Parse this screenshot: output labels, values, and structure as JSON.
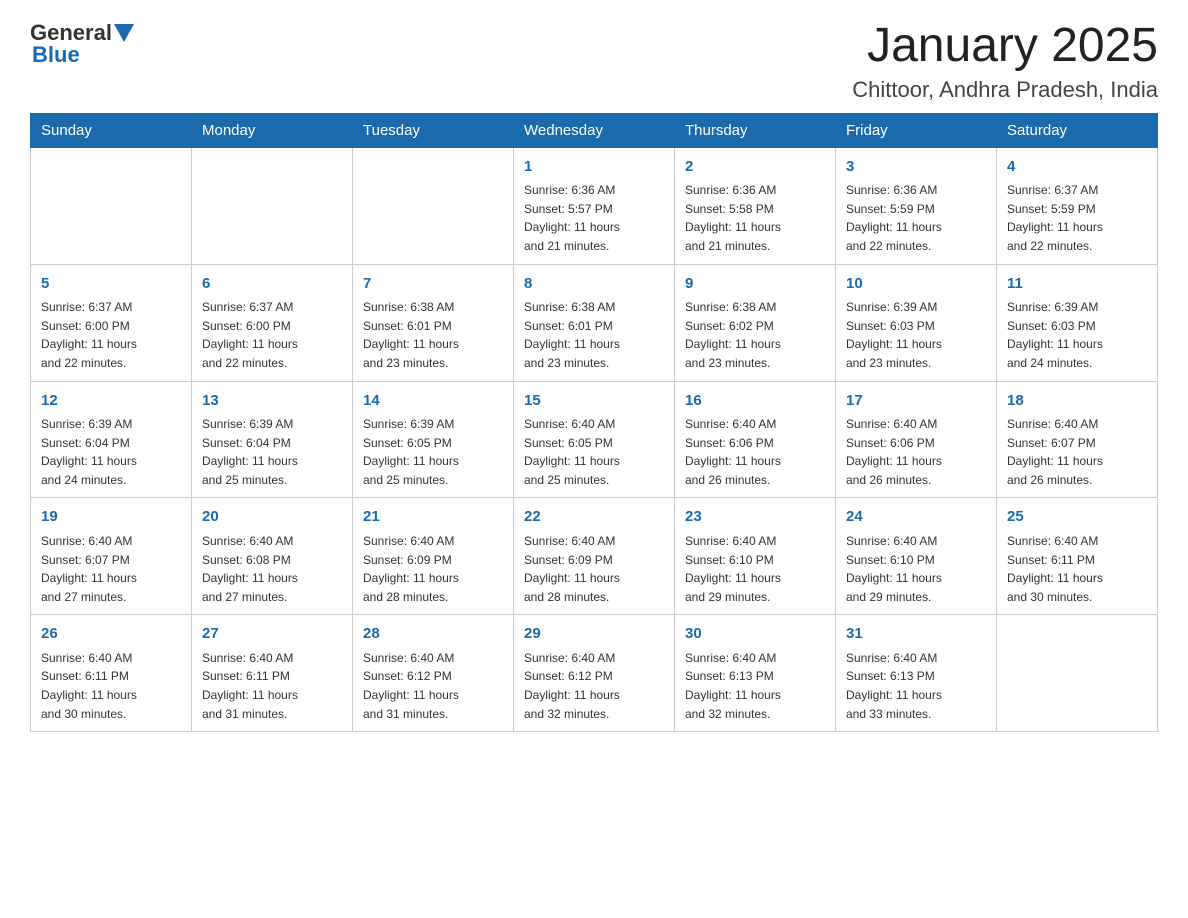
{
  "header": {
    "logo_general": "General",
    "logo_blue": "Blue",
    "month_title": "January 2025",
    "location": "Chittoor, Andhra Pradesh, India"
  },
  "weekdays": [
    "Sunday",
    "Monday",
    "Tuesday",
    "Wednesday",
    "Thursday",
    "Friday",
    "Saturday"
  ],
  "weeks": [
    [
      {
        "day": "",
        "info": ""
      },
      {
        "day": "",
        "info": ""
      },
      {
        "day": "",
        "info": ""
      },
      {
        "day": "1",
        "info": "Sunrise: 6:36 AM\nSunset: 5:57 PM\nDaylight: 11 hours\nand 21 minutes."
      },
      {
        "day": "2",
        "info": "Sunrise: 6:36 AM\nSunset: 5:58 PM\nDaylight: 11 hours\nand 21 minutes."
      },
      {
        "day": "3",
        "info": "Sunrise: 6:36 AM\nSunset: 5:59 PM\nDaylight: 11 hours\nand 22 minutes."
      },
      {
        "day": "4",
        "info": "Sunrise: 6:37 AM\nSunset: 5:59 PM\nDaylight: 11 hours\nand 22 minutes."
      }
    ],
    [
      {
        "day": "5",
        "info": "Sunrise: 6:37 AM\nSunset: 6:00 PM\nDaylight: 11 hours\nand 22 minutes."
      },
      {
        "day": "6",
        "info": "Sunrise: 6:37 AM\nSunset: 6:00 PM\nDaylight: 11 hours\nand 22 minutes."
      },
      {
        "day": "7",
        "info": "Sunrise: 6:38 AM\nSunset: 6:01 PM\nDaylight: 11 hours\nand 23 minutes."
      },
      {
        "day": "8",
        "info": "Sunrise: 6:38 AM\nSunset: 6:01 PM\nDaylight: 11 hours\nand 23 minutes."
      },
      {
        "day": "9",
        "info": "Sunrise: 6:38 AM\nSunset: 6:02 PM\nDaylight: 11 hours\nand 23 minutes."
      },
      {
        "day": "10",
        "info": "Sunrise: 6:39 AM\nSunset: 6:03 PM\nDaylight: 11 hours\nand 23 minutes."
      },
      {
        "day": "11",
        "info": "Sunrise: 6:39 AM\nSunset: 6:03 PM\nDaylight: 11 hours\nand 24 minutes."
      }
    ],
    [
      {
        "day": "12",
        "info": "Sunrise: 6:39 AM\nSunset: 6:04 PM\nDaylight: 11 hours\nand 24 minutes."
      },
      {
        "day": "13",
        "info": "Sunrise: 6:39 AM\nSunset: 6:04 PM\nDaylight: 11 hours\nand 25 minutes."
      },
      {
        "day": "14",
        "info": "Sunrise: 6:39 AM\nSunset: 6:05 PM\nDaylight: 11 hours\nand 25 minutes."
      },
      {
        "day": "15",
        "info": "Sunrise: 6:40 AM\nSunset: 6:05 PM\nDaylight: 11 hours\nand 25 minutes."
      },
      {
        "day": "16",
        "info": "Sunrise: 6:40 AM\nSunset: 6:06 PM\nDaylight: 11 hours\nand 26 minutes."
      },
      {
        "day": "17",
        "info": "Sunrise: 6:40 AM\nSunset: 6:06 PM\nDaylight: 11 hours\nand 26 minutes."
      },
      {
        "day": "18",
        "info": "Sunrise: 6:40 AM\nSunset: 6:07 PM\nDaylight: 11 hours\nand 26 minutes."
      }
    ],
    [
      {
        "day": "19",
        "info": "Sunrise: 6:40 AM\nSunset: 6:07 PM\nDaylight: 11 hours\nand 27 minutes."
      },
      {
        "day": "20",
        "info": "Sunrise: 6:40 AM\nSunset: 6:08 PM\nDaylight: 11 hours\nand 27 minutes."
      },
      {
        "day": "21",
        "info": "Sunrise: 6:40 AM\nSunset: 6:09 PM\nDaylight: 11 hours\nand 28 minutes."
      },
      {
        "day": "22",
        "info": "Sunrise: 6:40 AM\nSunset: 6:09 PM\nDaylight: 11 hours\nand 28 minutes."
      },
      {
        "day": "23",
        "info": "Sunrise: 6:40 AM\nSunset: 6:10 PM\nDaylight: 11 hours\nand 29 minutes."
      },
      {
        "day": "24",
        "info": "Sunrise: 6:40 AM\nSunset: 6:10 PM\nDaylight: 11 hours\nand 29 minutes."
      },
      {
        "day": "25",
        "info": "Sunrise: 6:40 AM\nSunset: 6:11 PM\nDaylight: 11 hours\nand 30 minutes."
      }
    ],
    [
      {
        "day": "26",
        "info": "Sunrise: 6:40 AM\nSunset: 6:11 PM\nDaylight: 11 hours\nand 30 minutes."
      },
      {
        "day": "27",
        "info": "Sunrise: 6:40 AM\nSunset: 6:11 PM\nDaylight: 11 hours\nand 31 minutes."
      },
      {
        "day": "28",
        "info": "Sunrise: 6:40 AM\nSunset: 6:12 PM\nDaylight: 11 hours\nand 31 minutes."
      },
      {
        "day": "29",
        "info": "Sunrise: 6:40 AM\nSunset: 6:12 PM\nDaylight: 11 hours\nand 32 minutes."
      },
      {
        "day": "30",
        "info": "Sunrise: 6:40 AM\nSunset: 6:13 PM\nDaylight: 11 hours\nand 32 minutes."
      },
      {
        "day": "31",
        "info": "Sunrise: 6:40 AM\nSunset: 6:13 PM\nDaylight: 11 hours\nand 33 minutes."
      },
      {
        "day": "",
        "info": ""
      }
    ]
  ]
}
